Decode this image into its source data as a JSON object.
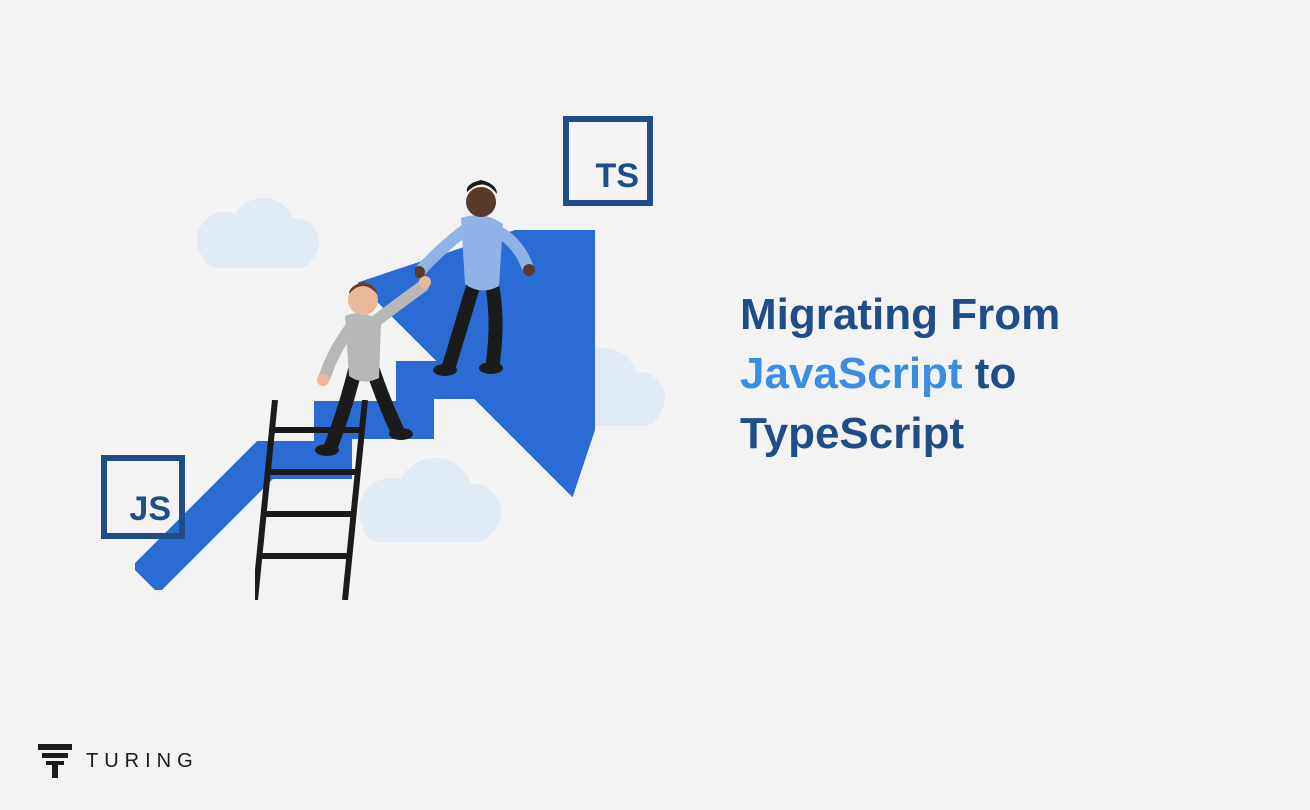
{
  "headline": {
    "pre": "Migrating From ",
    "accent": "JavaScript",
    "post": " to TypeScript"
  },
  "badges": {
    "js": "JS",
    "ts": "TS"
  },
  "brand": {
    "name": "TURING"
  },
  "colors": {
    "primary": "#1f4d87",
    "accent": "#3a8de0",
    "arrow": "#2b6cd4",
    "background": "#f3f3f3",
    "cloud": "#d9e6f2"
  }
}
